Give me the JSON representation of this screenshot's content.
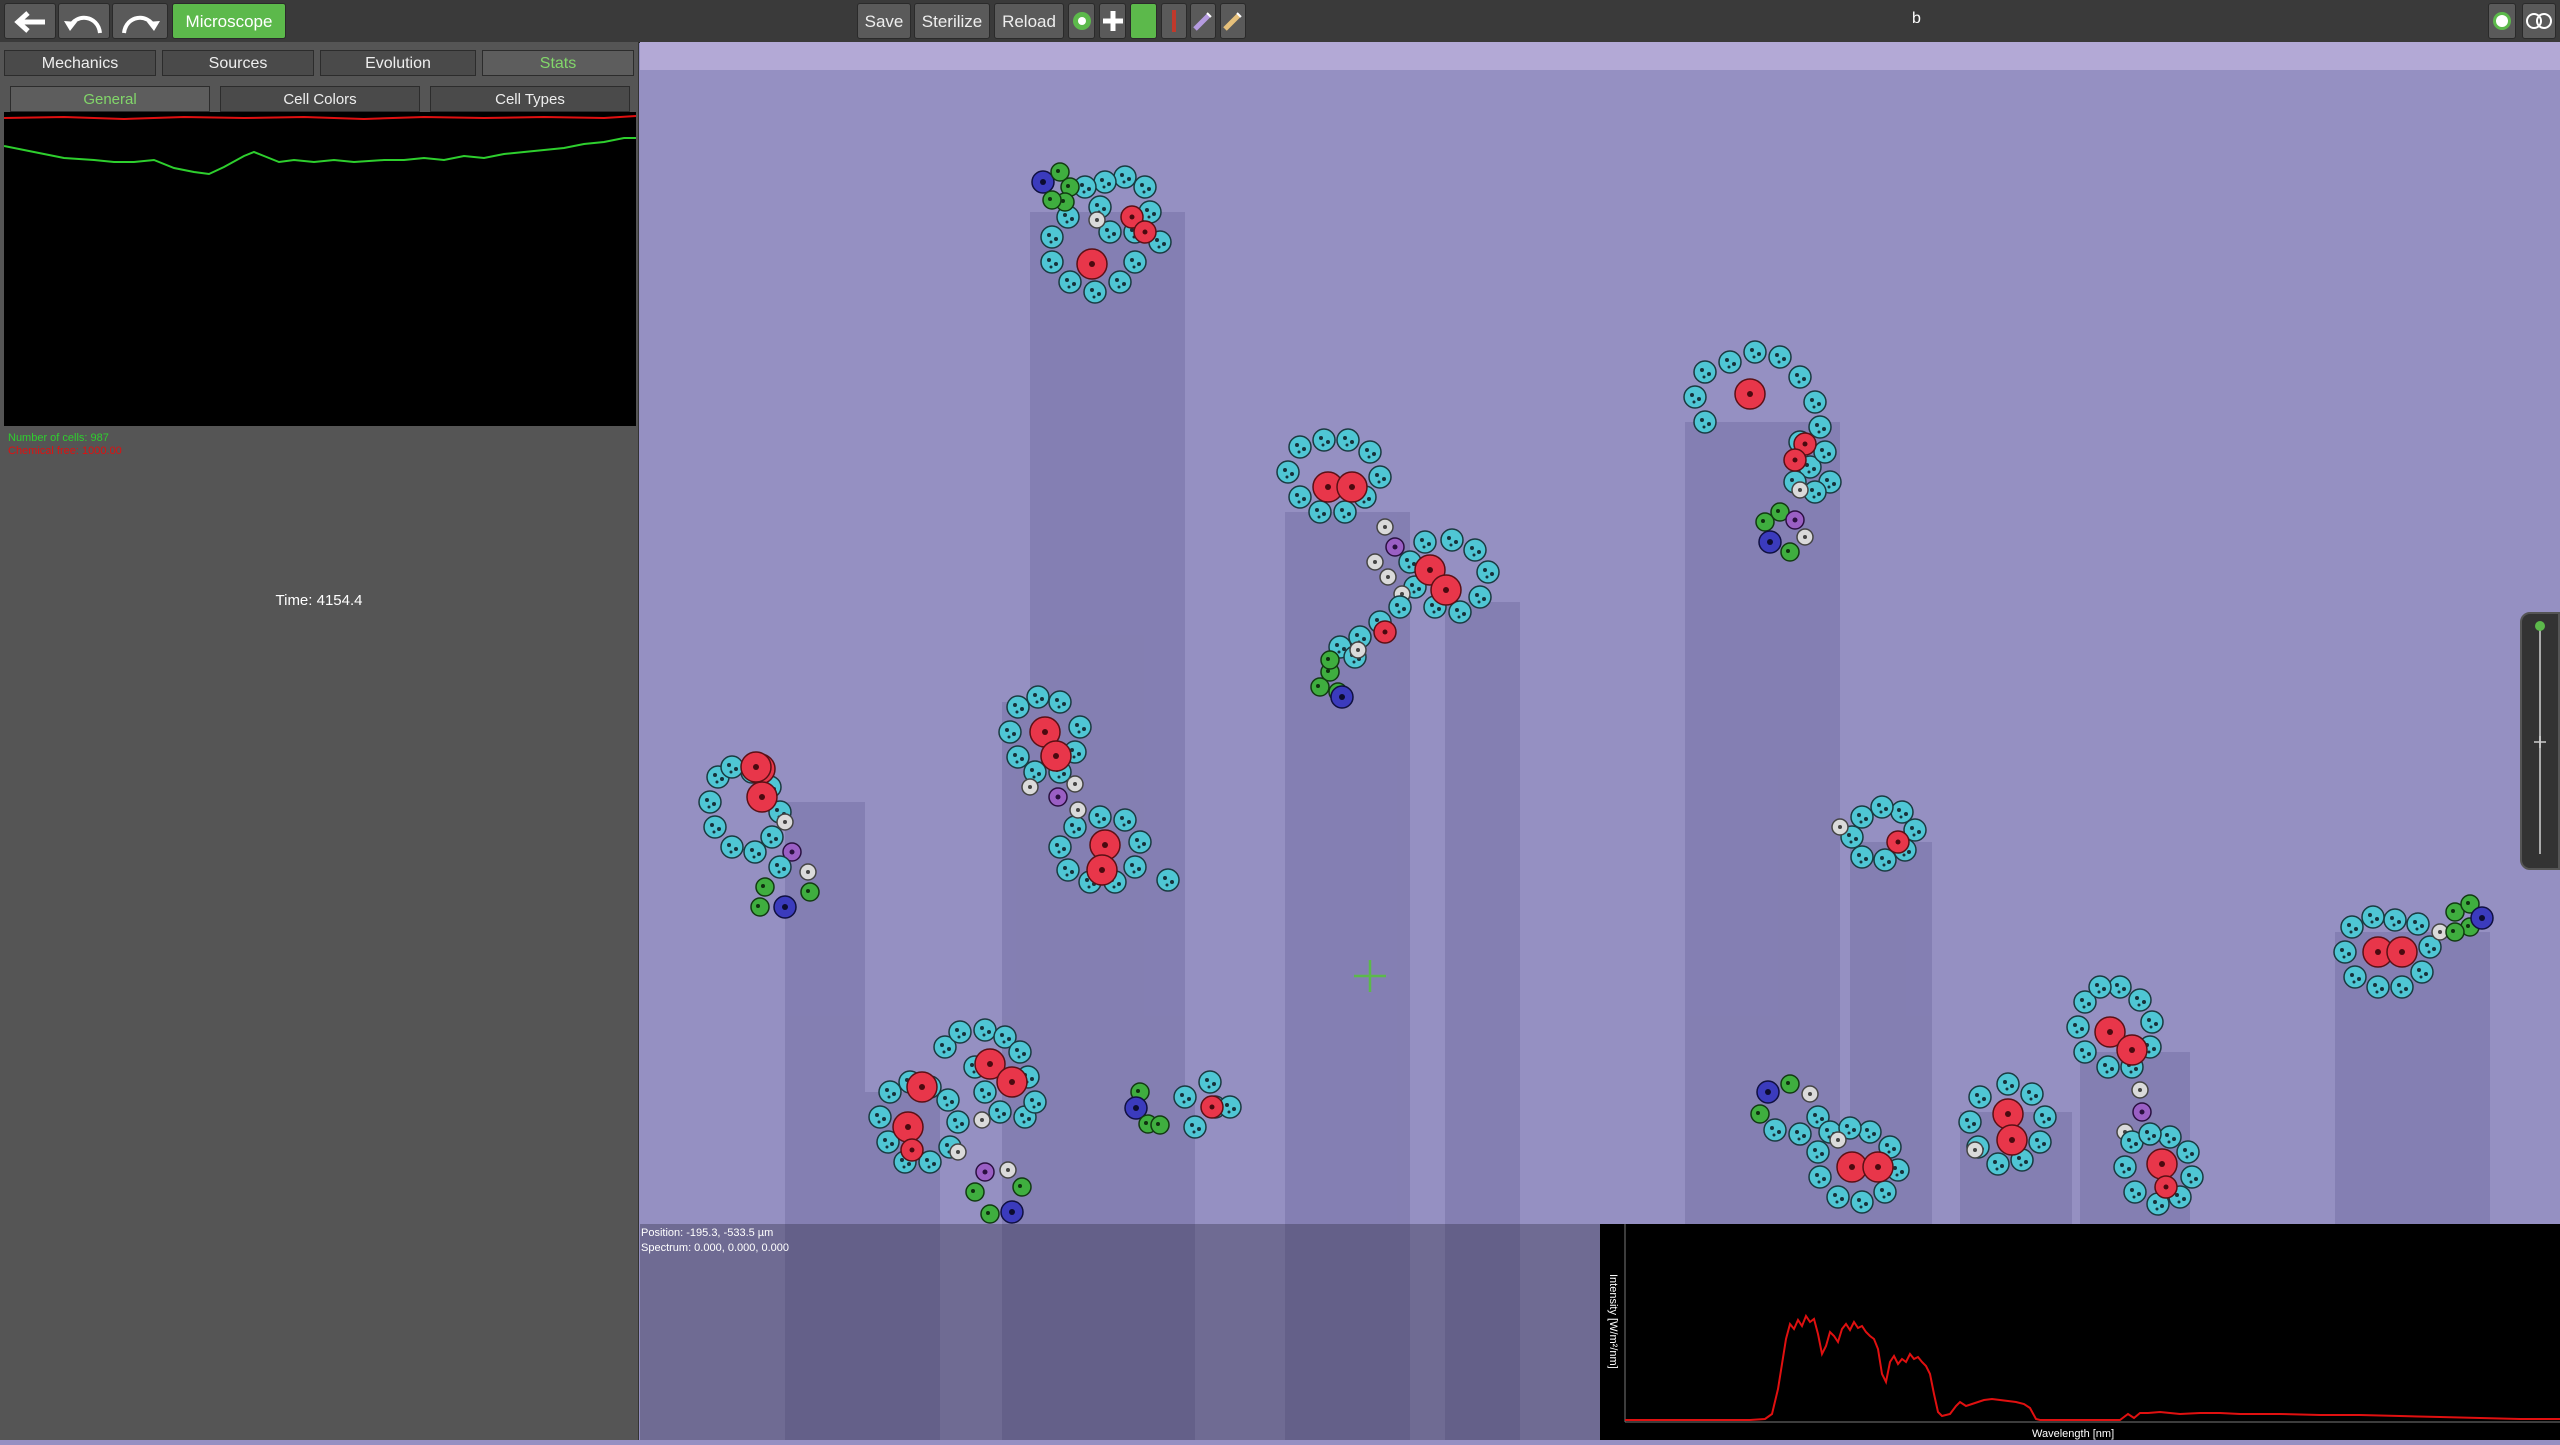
{
  "toolbar": {
    "back_icon": "arrow-left-icon",
    "undo_icon": "undo-icon",
    "redo_icon": "redo-icon",
    "mode_label": "Microscope",
    "save_label": "Save",
    "sterilize_label": "Sterilize",
    "reload_label": "Reload",
    "center_text": "b",
    "accent_color": "#5cb94b"
  },
  "tabs": [
    "Mechanics",
    "Sources",
    "Evolution",
    "Stats"
  ],
  "active_tab": "Stats",
  "subtabs": [
    "General",
    "Cell Colors",
    "Cell Types"
  ],
  "active_subtab": "General",
  "stats": {
    "cells_label": "Number of cells: 987",
    "energy_label": "Chemical free: 1000.00",
    "time_label": "Time: 4154.4"
  },
  "overlay": {
    "position": "Position: -195.3, -533.5 µm",
    "spectrum": "Spectrum: 0.000, 0.000, 0.000"
  },
  "spectrum_chart": {
    "xlabel": "Wavelength [nm]",
    "ylabel": "Intensity [W/m²/nm]"
  }
}
